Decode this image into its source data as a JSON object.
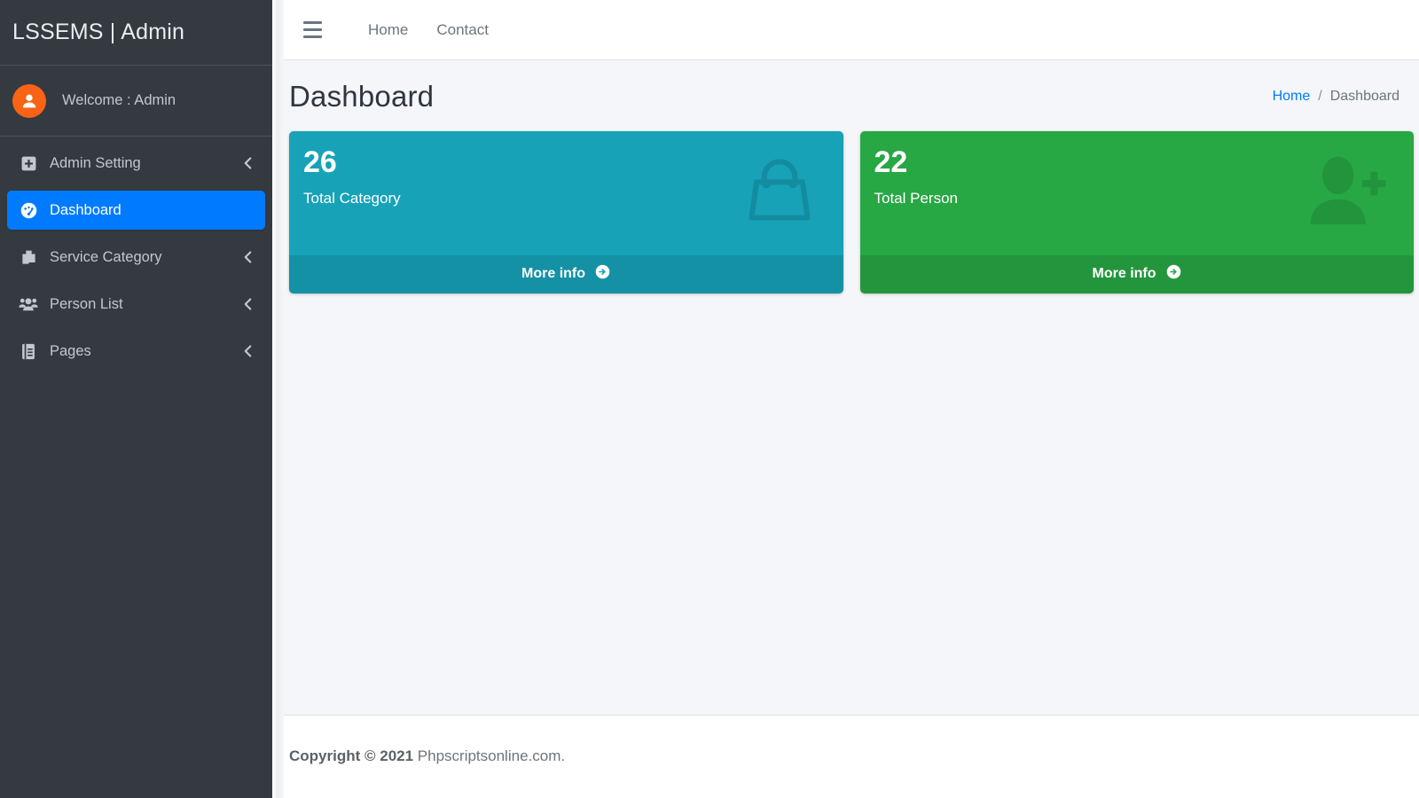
{
  "sidebar": {
    "brand": "LSSEMS | Admin",
    "user": {
      "welcome": "Welcome : Admin",
      "avatar_icon": "user-icon",
      "avatar_color": "#f96316"
    },
    "active_color": "#007bff",
    "background_color": "#343a40",
    "items": [
      {
        "label": "Admin Setting",
        "icon": "plus-square-icon",
        "has_arrow": true,
        "active": false
      },
      {
        "label": "Dashboard",
        "icon": "tachometer-icon",
        "has_arrow": false,
        "active": true
      },
      {
        "label": "Service Category",
        "icon": "copy-files-icon",
        "has_arrow": true,
        "active": false
      },
      {
        "label": "Person List",
        "icon": "users-icon",
        "has_arrow": true,
        "active": false
      },
      {
        "label": "Pages",
        "icon": "book-icon",
        "has_arrow": true,
        "active": false
      }
    ],
    "arrow_icon": "chevron-left-icon"
  },
  "navbar": {
    "toggle_icon": "hamburger-icon",
    "links": [
      {
        "label": "Home"
      },
      {
        "label": "Contact"
      }
    ]
  },
  "content": {
    "page_title": "Dashboard",
    "breadcrumb": {
      "home": "Home",
      "separator": "/",
      "current": "Dashboard"
    },
    "cards": [
      {
        "count": "26",
        "label": "Total Category",
        "footer_label": "More info",
        "footer_icon": "arrow-circle-right-icon",
        "watermark_icon": "shopping-bag-icon",
        "color": "#17a2b8"
      },
      {
        "count": "22",
        "label": "Total Person",
        "footer_label": "More info",
        "footer_icon": "arrow-circle-right-icon",
        "watermark_icon": "user-plus-icon",
        "color": "#28a745"
      }
    ]
  },
  "footer": {
    "copyright_strong": "Copyright © 2021",
    "copyright_text": " Phpscriptsonline.com."
  }
}
